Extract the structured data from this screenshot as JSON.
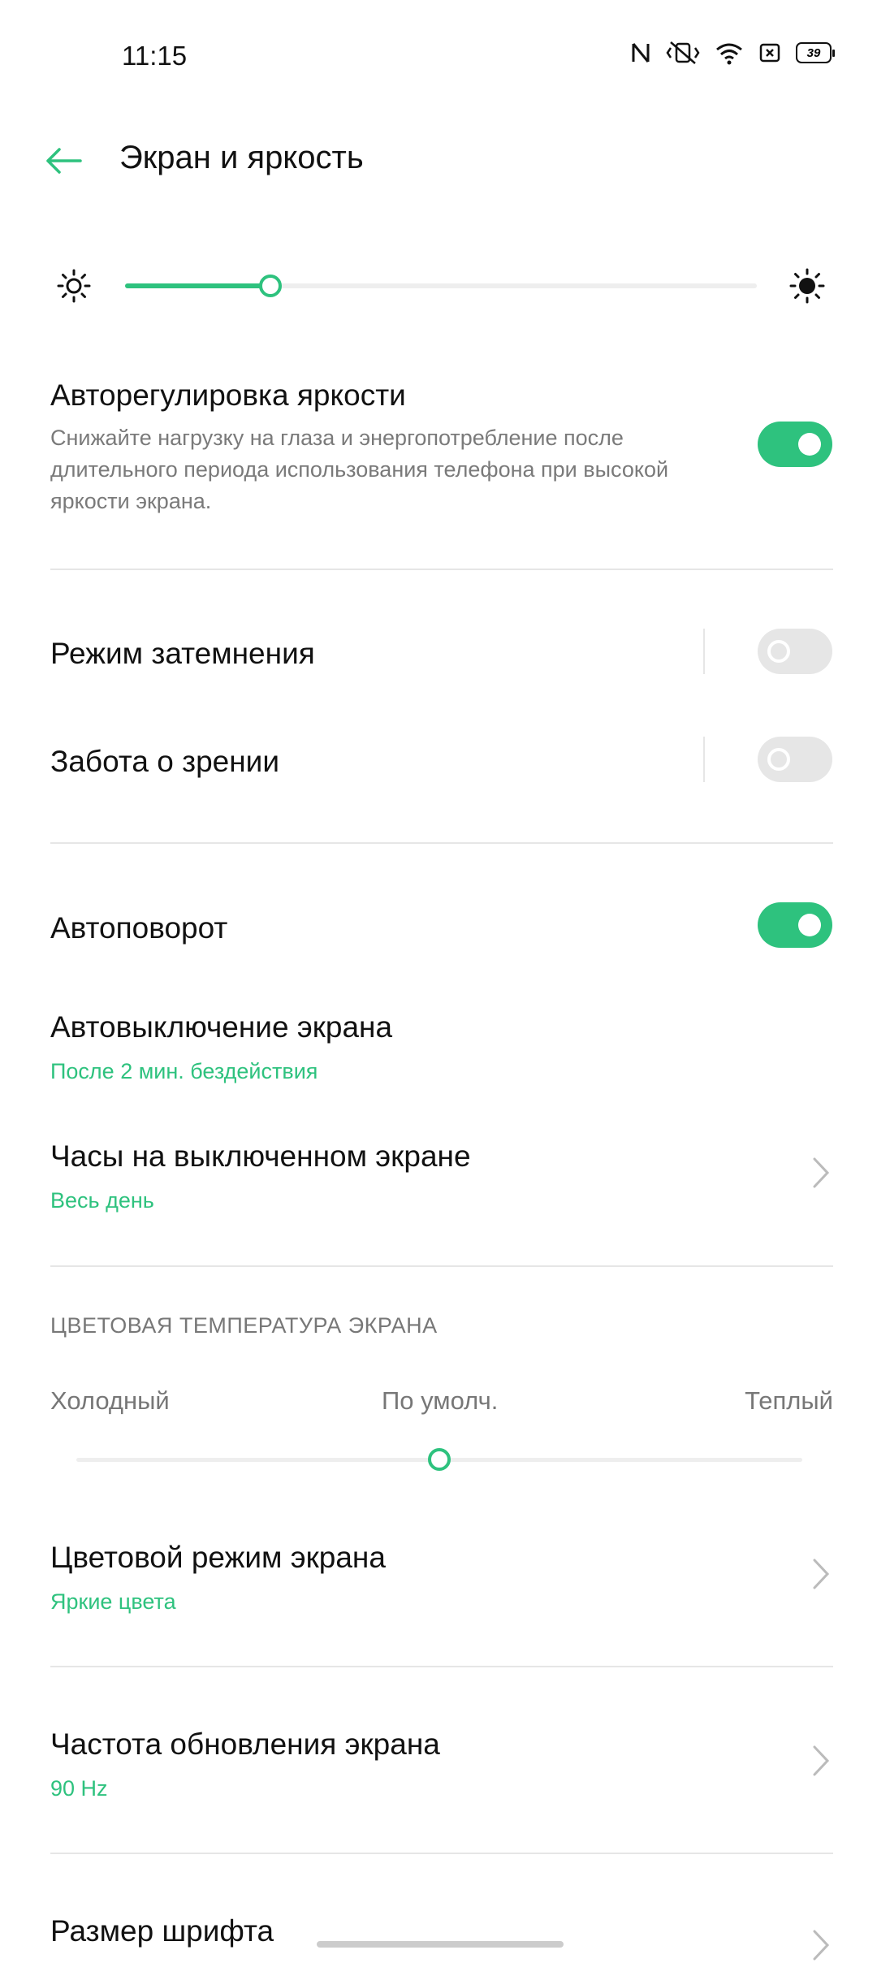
{
  "status_bar": {
    "time": "11:15",
    "battery": "39"
  },
  "header": {
    "title": "Экран и яркость"
  },
  "brightness": {
    "level_percent": 23
  },
  "auto_brightness": {
    "title": "Авторегулировка яркости",
    "description": "Снижайте нагрузку на глаза и энергопотребление после длительного периода использования телефона при высокой яркости экрана.",
    "enabled": true
  },
  "dark_mode": {
    "title": "Режим затемнения",
    "enabled": false
  },
  "eye_care": {
    "title": "Забота о зрении",
    "enabled": false
  },
  "auto_rotate": {
    "title": "Автоповорот",
    "enabled": true
  },
  "screen_timeout": {
    "title": "Автовыключение экрана",
    "value": "После 2 мин. бездействия"
  },
  "aod_clock": {
    "title": "Часы на выключенном экране",
    "value": "Весь день"
  },
  "color_temp": {
    "header": "ЦВЕТОВАЯ ТЕМПЕРАТУРА ЭКРАНА",
    "cold": "Холодный",
    "default": "По умолч.",
    "warm": "Теплый",
    "position_percent": 50
  },
  "color_mode": {
    "title": "Цветовой режим экрана",
    "value": "Яркие цвета"
  },
  "refresh_rate": {
    "title": "Частота обновления экрана",
    "value": "90 Hz"
  },
  "font_size": {
    "title": "Размер шрифта"
  },
  "colors": {
    "accent": "#2ec27e",
    "toggle_off": "#e6e6e6",
    "secondary_text": "#7a7a7a"
  }
}
